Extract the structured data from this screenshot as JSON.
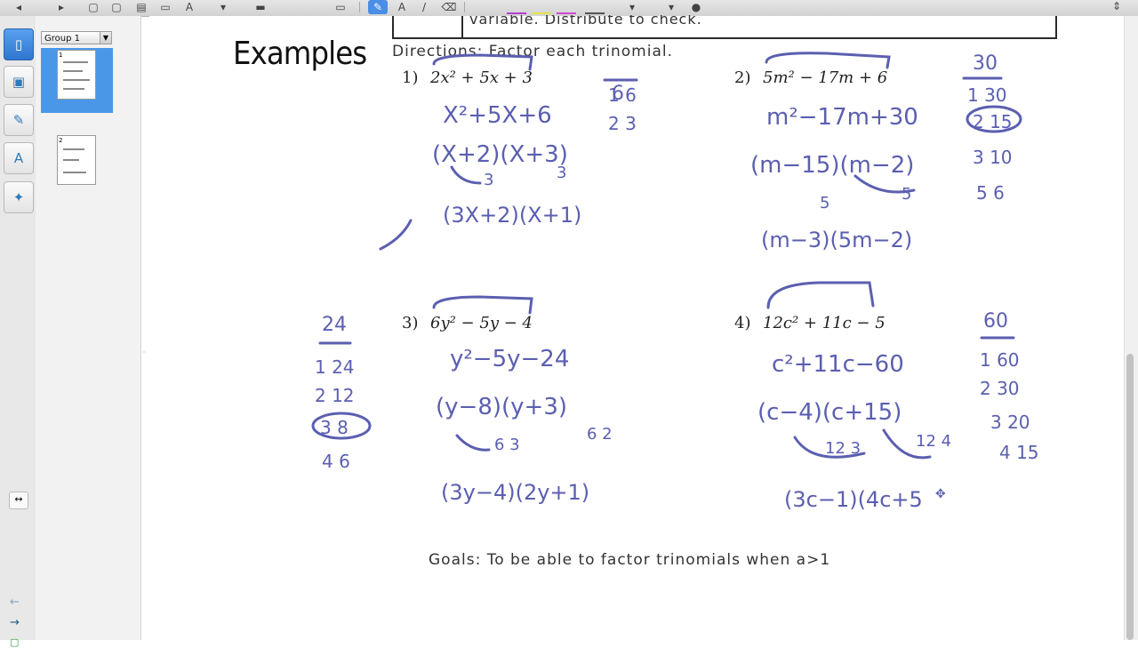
{
  "sorter": {
    "group_label": "Group 1",
    "pages": [
      "1",
      "2"
    ]
  },
  "page": {
    "header_box_text": "variable. Distribute to check.",
    "title": "Examples",
    "directions": "Directions: Factor each trinomial.",
    "goals": "Goals: To be able to factor trinomials when a>1"
  },
  "problems": [
    {
      "num": "1)",
      "expr_html": "2x² + 5x + 3"
    },
    {
      "num": "2)",
      "expr_html": "5m² − 17m + 6"
    },
    {
      "num": "3)",
      "expr_html": "6y² − 5y − 4"
    },
    {
      "num": "4)",
      "expr_html": "12c² + 11c − 5"
    }
  ],
  "ink": {
    "p1_factors": [
      "6",
      "1 6",
      "2 3"
    ],
    "p1_step1": "X²+5X+6",
    "p1_step2": "(X+2)(X+3)",
    "p1_div": [
      "3",
      "3"
    ],
    "p1_answer": "(3X+2)(X+1)",
    "p2_factors": [
      "30",
      "1 30",
      "2 15",
      "3 10",
      "5 6"
    ],
    "p2_step1": "m²−17m+30",
    "p2_step2": "(m−15)(m−2)",
    "p2_div": [
      "5",
      "5"
    ],
    "p2_answer": "(m−3)(5m−2)",
    "p3_factors": [
      "24",
      "1 24",
      "2 12",
      "3 8",
      "4 6"
    ],
    "p3_step1": "y²−5y−24",
    "p3_step2": "(y−8)(y+3)",
    "p3_div": [
      "6 3",
      "6 2"
    ],
    "p3_answer": "(3y−4)(2y+1)",
    "p4_factors": [
      "60",
      "1 60",
      "2 30",
      "3 20",
      "4 15"
    ],
    "p4_step1": "c²+11c−60",
    "p4_step2": "(c−4)(c+15)",
    "p4_div": [
      "12 3",
      "12 4"
    ],
    "p4_answer": "(3c−1)(4c+5"
  },
  "colors": {
    "ink": "#5b5fb0",
    "selection": "#4a97e8",
    "active_tool": "#4a8ee6"
  }
}
